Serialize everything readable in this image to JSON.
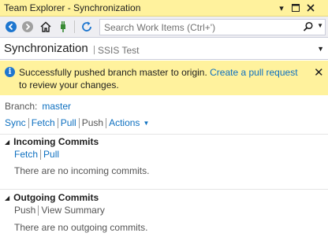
{
  "window": {
    "title": "Team Explorer - Synchronization",
    "controls": [
      "dropdown",
      "maximize",
      "close"
    ]
  },
  "toolbar": {
    "search_placeholder": "Search Work Items (Ctrl+')"
  },
  "header": {
    "title": "Synchronization",
    "subtitle": "SSIS Test"
  },
  "info_bar": {
    "message_before": "Successfully pushed branch master to origin.",
    "link_text": "Create a pull request",
    "message_after": "to review your changes."
  },
  "branch": {
    "label": "Branch:",
    "value": "master"
  },
  "actions": {
    "sync": "Sync",
    "fetch": "Fetch",
    "pull": "Pull",
    "push": "Push",
    "actions": "Actions"
  },
  "incoming": {
    "title": "Incoming Commits",
    "fetch": "Fetch",
    "pull": "Pull",
    "empty": "There are no incoming commits."
  },
  "outgoing": {
    "title": "Outgoing Commits",
    "push": "Push",
    "view_summary": "View Summary",
    "empty": "There are no outgoing commits."
  },
  "colors": {
    "title_bar": "#fff29d",
    "info_bar": "#fff29d",
    "link": "#0e70c0",
    "toolbar": "#eeeef2"
  }
}
